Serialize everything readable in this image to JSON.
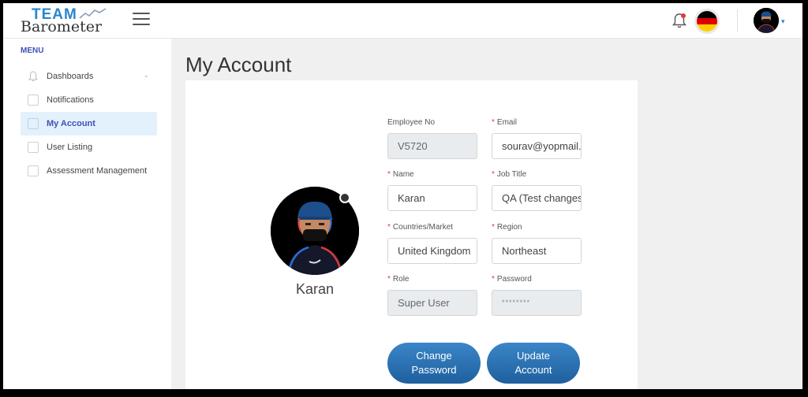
{
  "logo": {
    "line1": "TEAM",
    "line2": "Barometer"
  },
  "header": {
    "language": "German",
    "flag_colors": [
      "#000000",
      "#dd0000",
      "#ffce00"
    ]
  },
  "sidebar": {
    "menu_label": "MENU",
    "items": [
      {
        "label": "Dashboards",
        "icon": "dashboard-icon",
        "has_submenu": true
      },
      {
        "label": "Notifications",
        "icon": "notifications-icon"
      },
      {
        "label": "My Account",
        "icon": "account-icon",
        "active": true
      },
      {
        "label": "User Listing",
        "icon": "users-icon"
      },
      {
        "label": "Assessment Management",
        "icon": "assessment-icon"
      }
    ]
  },
  "page": {
    "title": "My Account"
  },
  "profile": {
    "name": "Karan"
  },
  "form": {
    "employee_no": {
      "label": "Employee No",
      "value": "V5720",
      "required": false
    },
    "email": {
      "label": "Email",
      "value": "sourav@yopmail.com",
      "required": true
    },
    "name": {
      "label": "Name",
      "value": "Karan",
      "required": true
    },
    "job_title": {
      "label": "Job Title",
      "value": "QA (Test changes)",
      "required": true
    },
    "countries": {
      "label": "Countries/Market",
      "value": "United Kingdom",
      "required": true
    },
    "region": {
      "label": "Region",
      "value": "Northeast",
      "required": true
    },
    "role": {
      "label": "Role",
      "value": "Super User",
      "required": true
    },
    "password": {
      "label": "Password",
      "value": "********",
      "required": true
    },
    "required_marker": "*"
  },
  "buttons": {
    "change_password_l1": "Change",
    "change_password_l2": "Password",
    "update_account_l1": "Update",
    "update_account_l2": "Account"
  },
  "colors": {
    "accent": "#2c86c9",
    "button": "#2a6fb0",
    "active_nav_bg": "#e3f1fc",
    "required": "#e53935"
  }
}
